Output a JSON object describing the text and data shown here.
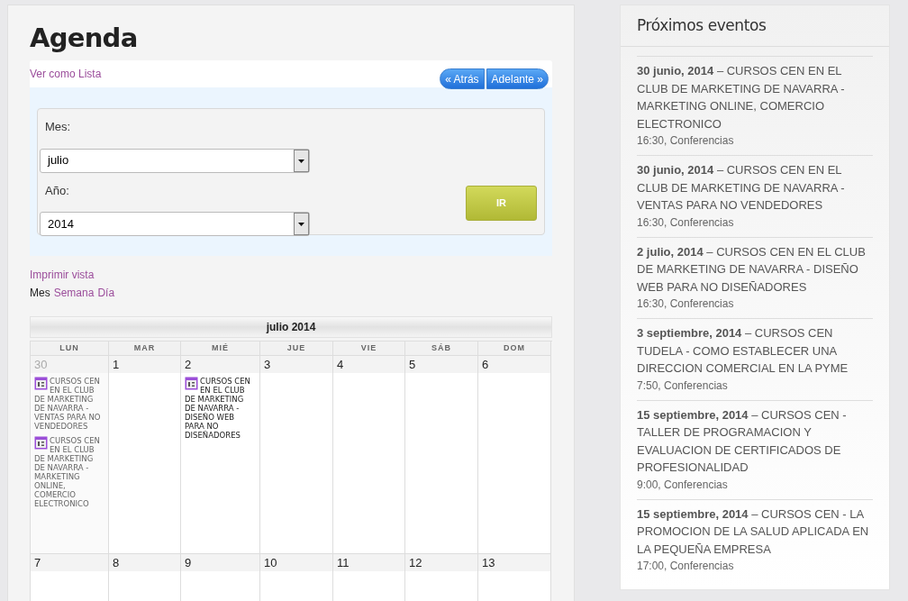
{
  "title": "Agenda",
  "list_link": "Ver como Lista",
  "nav_buttons": [
    "« Atrás",
    "Adelante »"
  ],
  "fields": [
    {
      "label": "Mes:",
      "value": "julio"
    },
    {
      "label": "Año:",
      "value": "2014"
    }
  ],
  "go_button": "IR",
  "print_link": "Imprimir vista",
  "view_modes": [
    {
      "label": "Mes",
      "selected": true
    },
    {
      "label": "Semana",
      "selected": false
    },
    {
      "label": "Día",
      "selected": false
    }
  ],
  "calendar": {
    "title": "julio 2014",
    "weekdays": [
      "LUN",
      "MAR",
      "MIÉ",
      "JUE",
      "VIE",
      "SÁB",
      "DOM"
    ],
    "weeks": [
      [
        {
          "day": "30",
          "muted": true,
          "events": [
            "CURSOS CEN EN EL CLUB DE MARKETING DE NAVARRA - VENTAS PARA NO VENDEDORES",
            "CURSOS CEN EN EL CLUB DE MARKETING DE NAVARRA - MARKETING ONLINE, COMERCIO ELECTRONICO"
          ]
        },
        {
          "day": "1",
          "muted": false
        },
        {
          "day": "2",
          "muted": false,
          "events": [
            "CURSOS CEN EN EL CLUB DE MARKETING DE NAVARRA - DISEÑO WEB PARA NO DISEÑADORES"
          ]
        },
        {
          "day": "3",
          "muted": false
        },
        {
          "day": "4",
          "muted": false
        },
        {
          "day": "5",
          "muted": false
        },
        {
          "day": "6",
          "muted": false
        }
      ],
      [
        {
          "day": "7",
          "muted": false
        },
        {
          "day": "8",
          "muted": false
        },
        {
          "day": "9",
          "muted": false
        },
        {
          "day": "10",
          "muted": false
        },
        {
          "day": "11",
          "muted": false
        },
        {
          "day": "12",
          "muted": false
        },
        {
          "day": "13",
          "muted": false
        }
      ]
    ]
  },
  "sidebar": {
    "title": "Próximos eventos",
    "events": [
      {
        "text": "**30 junio, 2014** – CURSOS CEN EN EL CLUB DE MARKETING DE NAVARRA - MARKETING ONLINE, COMERCIO ELECTRONICO",
        "meta": "16:30, Conferencias"
      },
      {
        "text": "**30 junio, 2014** – CURSOS CEN EN EL CLUB DE MARKETING DE NAVARRA - VENTAS PARA NO VENDEDORES",
        "meta": "16:30, Conferencias"
      },
      {
        "text": "**2 julio, 2014** – CURSOS CEN EN EL CLUB DE MARKETING DE NAVARRA - DISEÑO WEB PARA NO DISEÑADORES",
        "meta": "16:30, Conferencias"
      },
      {
        "text": "**3 septiembre, 2014** – CURSOS CEN TUDELA - COMO ESTABLECER UNA DIRECCION COMERCIAL EN LA PYME",
        "meta": "7:50, Conferencias"
      },
      {
        "text": "**15 septiembre, 2014** – CURSOS CEN - TALLER DE PROGRAMACION Y EVALUACION DE CERTIFICADOS DE PROFESIONALIDAD",
        "meta": "9:00, Conferencias"
      },
      {
        "text": "**15 septiembre, 2014** – CURSOS CEN - LA PROMOCION DE LA SALUD APLICADA EN LA PEQUEÑA EMPRESA",
        "meta": "17:00, Conferencias"
      }
    ]
  }
}
